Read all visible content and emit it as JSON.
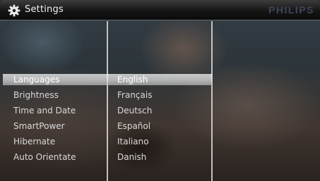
{
  "window": {
    "title": "Settings",
    "brand": "PHILIPS"
  },
  "menu": {
    "items": [
      {
        "label": "Languages"
      },
      {
        "label": "Brightness"
      },
      {
        "label": "Time and Date"
      },
      {
        "label": "SmartPower"
      },
      {
        "label": "Hibernate"
      },
      {
        "label": "Auto Orientate"
      }
    ],
    "selected_index": 0
  },
  "languages": {
    "options": [
      {
        "label": "English"
      },
      {
        "label": "Français"
      },
      {
        "label": "Deutsch"
      },
      {
        "label": "Español"
      },
      {
        "label": "Italiano"
      },
      {
        "label": "Danish"
      }
    ],
    "selected_index": 0
  },
  "icons": {
    "title_icon": "gear-icon"
  },
  "colors": {
    "title_bar": "#0a0a0a",
    "text": "#d9d9d9",
    "highlight": "#e4e4e4",
    "brand": "#3c4658"
  }
}
